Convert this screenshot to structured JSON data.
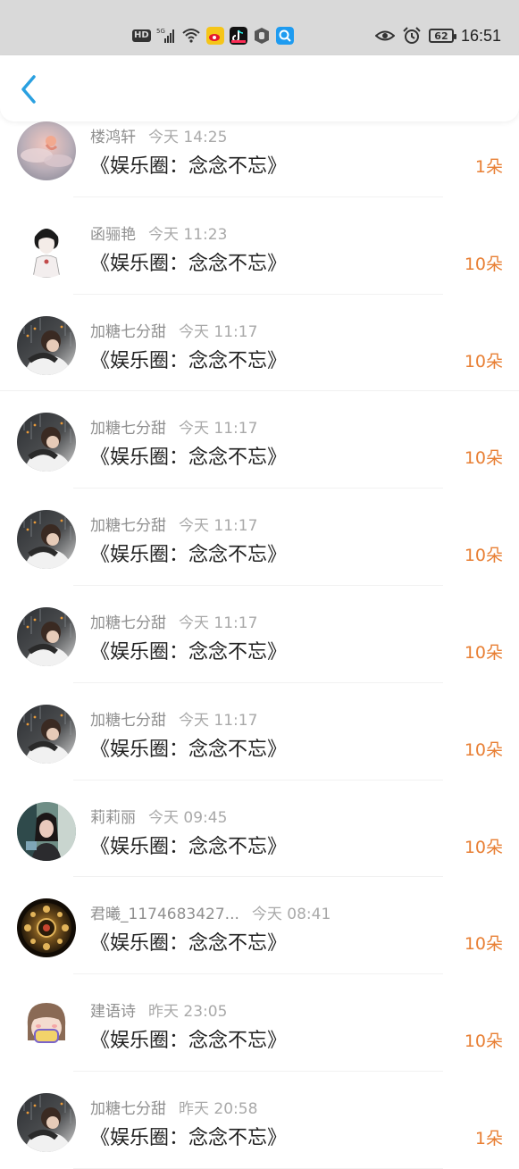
{
  "status_bar": {
    "hd_label": "HD",
    "network_label": "5G",
    "battery": "62",
    "time": "16:51"
  },
  "nav": {
    "back_icon": "chevron-left-icon",
    "accent": "#2aa0e0"
  },
  "colors": {
    "count": "#e87f34",
    "meta": "#a0a0a0",
    "title": "#222222"
  },
  "records": [
    {
      "name": "楼鸿轩",
      "time": "今天 14:25",
      "title": "《娱乐圈：念念不忘》",
      "count": "1朵",
      "avatar": "pink-sky"
    },
    {
      "name": "函骊艳",
      "time": "今天 11:23",
      "title": "《娱乐圈：念念不忘》",
      "count": "10朵",
      "avatar": "sketch"
    },
    {
      "name": "加糖七分甜",
      "time": "今天 11:17",
      "title": "《娱乐圈：念念不忘》",
      "count": "10朵",
      "avatar": "rain-boy"
    },
    {
      "name": "加糖七分甜",
      "time": "今天 11:17",
      "title": "《娱乐圈：念念不忘》",
      "count": "10朵",
      "avatar": "rain-boy"
    },
    {
      "name": "加糖七分甜",
      "time": "今天 11:17",
      "title": "《娱乐圈：念念不忘》",
      "count": "10朵",
      "avatar": "rain-boy"
    },
    {
      "name": "加糖七分甜",
      "time": "今天 11:17",
      "title": "《娱乐圈：念念不忘》",
      "count": "10朵",
      "avatar": "rain-boy"
    },
    {
      "name": "加糖七分甜",
      "time": "今天 11:17",
      "title": "《娱乐圈：念念不忘》",
      "count": "10朵",
      "avatar": "rain-boy"
    },
    {
      "name": "莉莉丽",
      "time": "今天 09:45",
      "title": "《娱乐圈：念念不忘》",
      "count": "10朵",
      "avatar": "photo-girl"
    },
    {
      "name": "君曦_1174683427...",
      "time": "今天 08:41",
      "title": "《娱乐圈：念念不忘》",
      "count": "10朵",
      "avatar": "ornament"
    },
    {
      "name": "建语诗",
      "time": "昨天 23:05",
      "title": "《娱乐圈：念念不忘》",
      "count": "10朵",
      "avatar": "cartoon"
    },
    {
      "name": "加糖七分甜",
      "time": "昨天 20:58",
      "title": "《娱乐圈：念念不忘》",
      "count": "1朵",
      "avatar": "rain-boy"
    }
  ]
}
